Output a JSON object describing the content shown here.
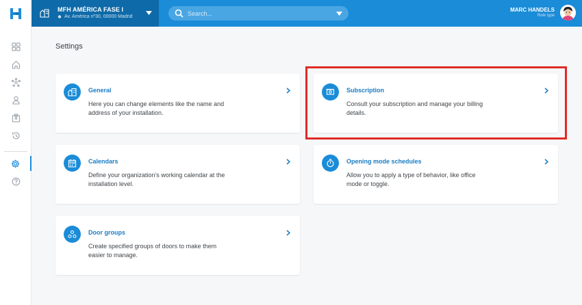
{
  "installation": {
    "name": "MFH AMÉRICA FASE I",
    "address": "Av. América nº30, 00000 Madrid"
  },
  "search": {
    "placeholder": "Search..."
  },
  "user": {
    "name": "MARC HANDELS",
    "role": "Role type"
  },
  "sidebar": {
    "items": [
      {
        "icon": "dashboard-icon"
      },
      {
        "icon": "home-icon"
      },
      {
        "icon": "network-icon"
      },
      {
        "icon": "user-icon"
      },
      {
        "icon": "badge-icon"
      },
      {
        "icon": "history-icon"
      },
      {
        "icon": "gear-icon",
        "active": true
      },
      {
        "icon": "help-icon"
      }
    ]
  },
  "page": {
    "title": "Settings"
  },
  "cards": [
    {
      "title": "General",
      "description": "Here you can change elements like the name and address of your installation.",
      "icon": "building-icon"
    },
    {
      "title": "Subscription",
      "description": "Consult your subscription and manage your billing details.",
      "icon": "money-icon"
    },
    {
      "title": "Calendars",
      "description": "Define your organization's working calendar at the installation level.",
      "icon": "calendar-icon"
    },
    {
      "title": "Opening mode schedules",
      "description": "Allow you to apply a type of behavior, like office mode or toggle.",
      "icon": "stopwatch-icon"
    },
    {
      "title": "Door groups",
      "description": "Create specified groups of doors to make them easier to manage.",
      "icon": "group-icon"
    }
  ],
  "colors": {
    "primary": "#1a8cd8",
    "dark_primary": "#0e6aa8",
    "highlight": "#e02a25"
  }
}
